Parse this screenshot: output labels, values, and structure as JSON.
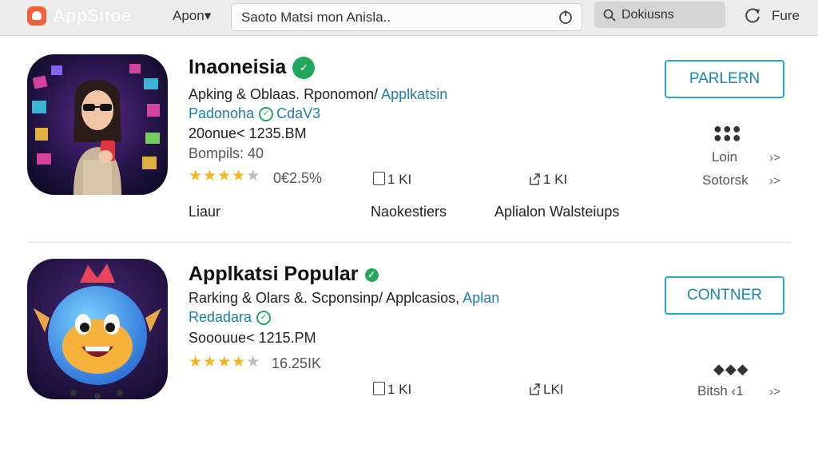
{
  "topbar": {
    "brand": "AppSitoe",
    "brand_dot": "·",
    "menu": "Apon▾",
    "search_value": "Saoto Matsi mon Anisla..",
    "filter_label": "Dokiusns",
    "reload_label": "Fure"
  },
  "apps": [
    {
      "title": "Inaoneisia",
      "verified_mark": "✓",
      "subtitle_plain": "Apking & Oblaas. Rponomon/ ",
      "subtitle_link": "Applkatsin",
      "developer": "Padonoha",
      "developer2": "CdaV3",
      "size": "20onue< 1235.BM",
      "reviews": "Bompils: 40",
      "rating_value": "0€2.5%",
      "rating_stars": 3.5,
      "stat1": "1 KI",
      "stat2": "1 KI",
      "tag1": "Liaur",
      "tag2": "Naokestiers",
      "tag3": "Aplialon Walsteiups",
      "button_label": "PARLERN",
      "side_dots": "●●●\n●●●",
      "side_label1": "Loin",
      "side_label2": "Sotorsk",
      "chevron": "›>"
    },
    {
      "title": "Applkatsi Popular",
      "verified_mark": "✓",
      "subtitle_plain": "Rarking & Olars &. Scponsinp/ Applcasios, ",
      "subtitle_link": "Aplan",
      "developer": "Redadara",
      "size": "Sooouue< 1215.PM",
      "rating_value": "16.25IK",
      "rating_stars": 4,
      "stat1": "1 KI",
      "stat2": "LKI",
      "button_label": "CONTNER",
      "side_dots": "◆◆◆",
      "side_label1": "Bitsh",
      "side_label1_suffix": "‹1",
      "chevron": "›>"
    }
  ],
  "colors": {
    "accent": "#2aa7c9",
    "verified": "#22a85a",
    "link": "#1e7fa8",
    "star": "#f5b51c"
  }
}
